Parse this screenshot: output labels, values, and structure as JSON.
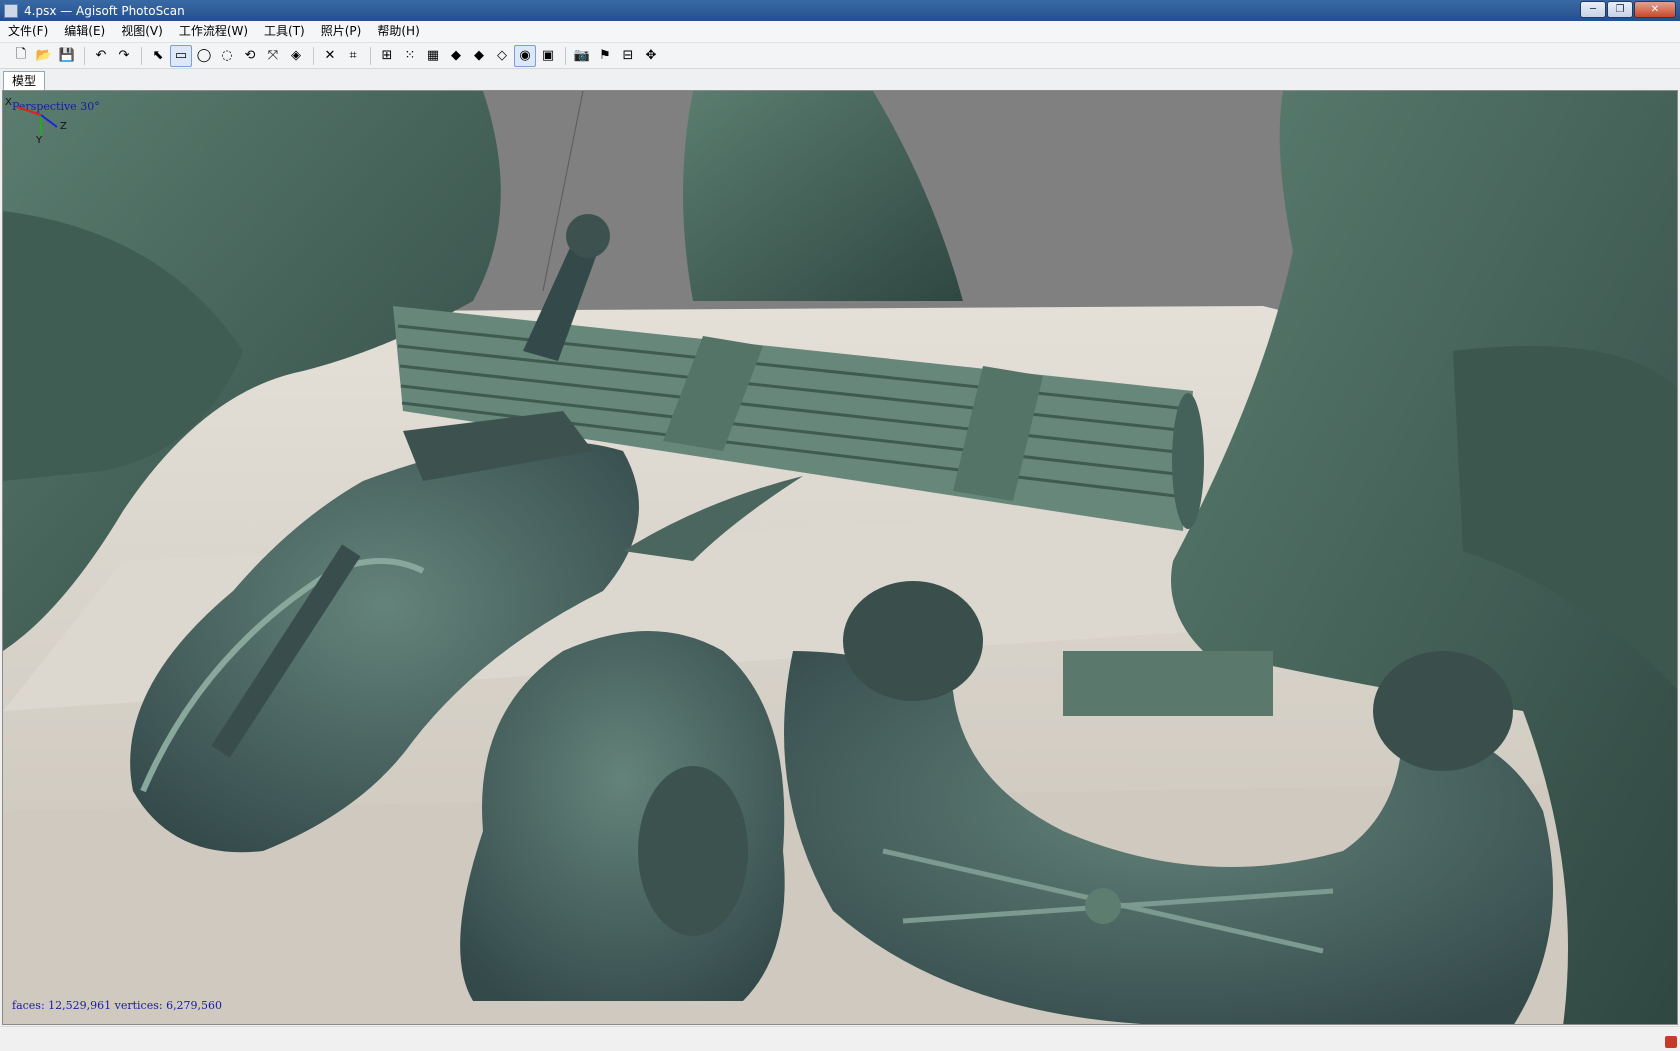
{
  "window": {
    "title": "4.psx — Agisoft PhotoScan",
    "minimize": "─",
    "maximize": "❐",
    "close": "✕"
  },
  "menu": [
    "文件(F)",
    "编辑(E)",
    "视图(V)",
    "工作流程(W)",
    "工具(T)",
    "照片(P)",
    "帮助(H)"
  ],
  "toolbar": [
    {
      "icon": "new-icon",
      "glyph": "🗋"
    },
    {
      "icon": "open-icon",
      "glyph": "📂"
    },
    {
      "icon": "save-icon",
      "glyph": "💾"
    },
    {
      "sep": true
    },
    {
      "icon": "undo-icon",
      "glyph": "↶"
    },
    {
      "icon": "redo-icon",
      "glyph": "↷"
    },
    {
      "sep": true
    },
    {
      "icon": "navigation-icon",
      "glyph": "⬉"
    },
    {
      "icon": "rectangle-selection-icon",
      "glyph": "▭",
      "active": true
    },
    {
      "icon": "circle-selection-icon",
      "glyph": "◯"
    },
    {
      "icon": "free-form-selection-icon",
      "glyph": "◌"
    },
    {
      "icon": "rotate-object-icon",
      "glyph": "⟲"
    },
    {
      "icon": "move-object-icon",
      "glyph": "⤧"
    },
    {
      "icon": "scale-object-icon",
      "glyph": "◈"
    },
    {
      "sep": true
    },
    {
      "icon": "delete-selection-icon",
      "glyph": "✕"
    },
    {
      "icon": "crop-selection-icon",
      "glyph": "⌗"
    },
    {
      "sep": true
    },
    {
      "icon": "show-cameras-icon",
      "glyph": "⊞"
    },
    {
      "icon": "show-points-icon",
      "glyph": "⁙"
    },
    {
      "icon": "show-dense-cloud-icon",
      "glyph": "▦"
    },
    {
      "icon": "shaded-model-icon",
      "glyph": "◆"
    },
    {
      "icon": "solid-model-icon",
      "glyph": "◆"
    },
    {
      "icon": "wireframe-model-icon",
      "glyph": "◇"
    },
    {
      "icon": "textured-model-icon",
      "glyph": "◉",
      "active": true
    },
    {
      "icon": "tiled-model-icon",
      "glyph": "▣"
    },
    {
      "sep": true
    },
    {
      "icon": "camera-icon",
      "glyph": "📷"
    },
    {
      "icon": "markers-icon",
      "glyph": "⚑"
    },
    {
      "icon": "region-icon",
      "glyph": "⊟"
    },
    {
      "icon": "reset-view-icon",
      "glyph": "✥"
    }
  ],
  "tabs": {
    "model": "模型"
  },
  "viewport": {
    "projection": "Perspective 30°",
    "stats": "faces: 12,529,961 vertices: 6,279,560",
    "axes": {
      "x": "X",
      "y": "Y",
      "z": "Z"
    }
  },
  "colors": {
    "bronze": "#4f6e62",
    "bronze_dark": "#2f4540",
    "stone": "#d6d1c8",
    "background": "#808080"
  }
}
